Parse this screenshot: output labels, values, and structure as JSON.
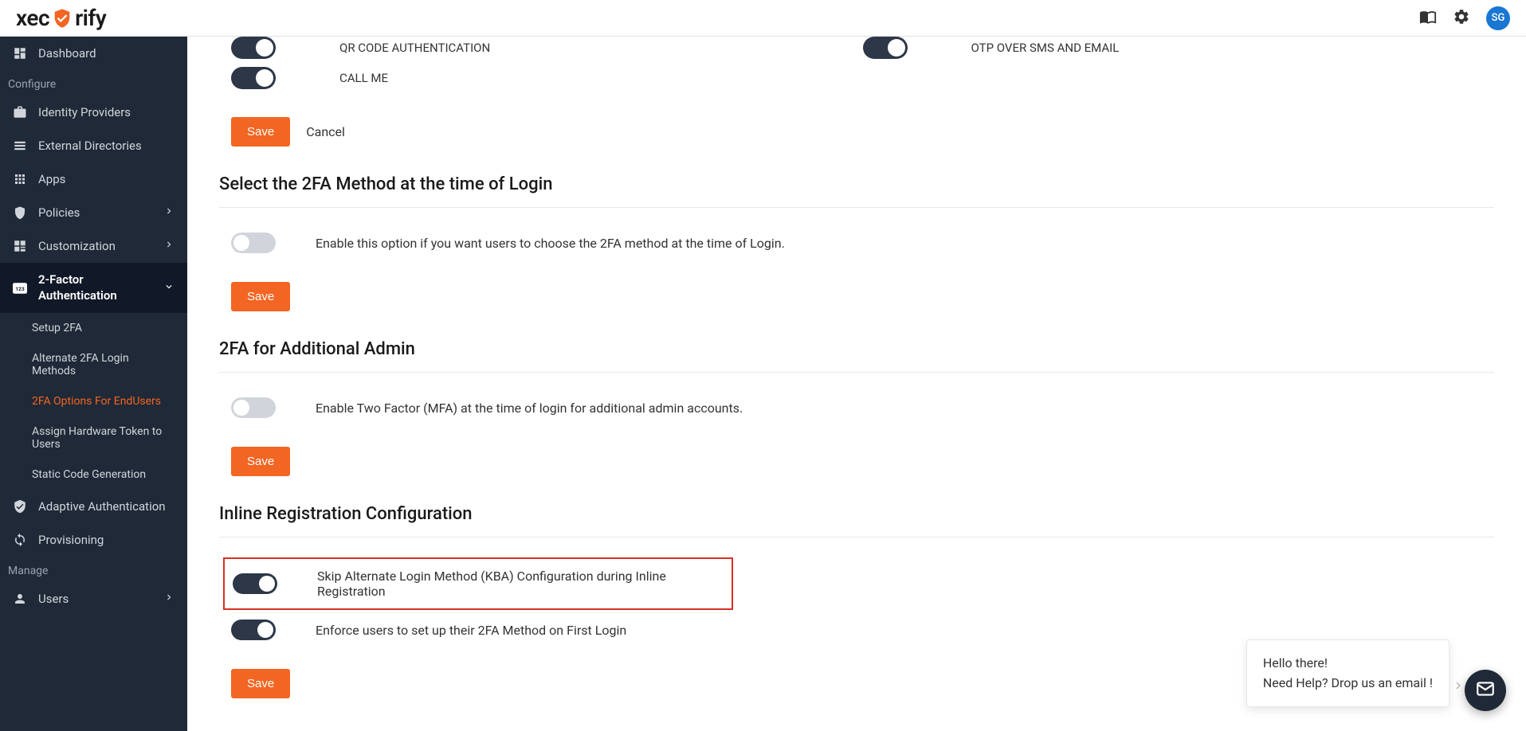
{
  "brand": {
    "name_pre": "xec",
    "name_post": "rify"
  },
  "header": {
    "avatar_initials": "SG"
  },
  "sidebar": {
    "dashboard": "Dashboard",
    "section_configure": "Configure",
    "identity_providers": "Identity Providers",
    "external_directories": "External Directories",
    "apps": "Apps",
    "policies": "Policies",
    "customization": "Customization",
    "two_factor": "2-Factor Authentication",
    "sub": {
      "setup_2fa": "Setup 2FA",
      "alternate_methods": "Alternate 2FA Login Methods",
      "options_endusers": "2FA Options For EndUsers",
      "assign_token": "Assign Hardware Token to Users",
      "static_code": "Static Code Generation"
    },
    "adaptive_auth": "Adaptive Authentication",
    "provisioning": "Provisioning",
    "section_manage": "Manage",
    "users": "Users"
  },
  "methods": {
    "qr_code": "QR CODE AUTHENTICATION",
    "call_me": "CALL ME",
    "otp_sms_email": "OTP OVER SMS AND EMAIL"
  },
  "actions": {
    "save": "Save",
    "cancel": "Cancel"
  },
  "sections": {
    "select_2fa_login": {
      "title": "Select the 2FA Method at the time of Login",
      "desc": "Enable this option if you want users to choose the 2FA method at the time of Login."
    },
    "additional_admin": {
      "title": "2FA for Additional Admin",
      "desc": "Enable Two Factor (MFA) at the time of login for additional admin accounts."
    },
    "inline_reg": {
      "title": "Inline Registration Configuration",
      "skip_kba": "Skip Alternate Login Method (KBA) Configuration during Inline Registration",
      "enforce_first": "Enforce users to set up their 2FA Method on First Login"
    }
  },
  "chat": {
    "greeting": "Hello there!",
    "help": "Need Help? Drop us an email !"
  }
}
